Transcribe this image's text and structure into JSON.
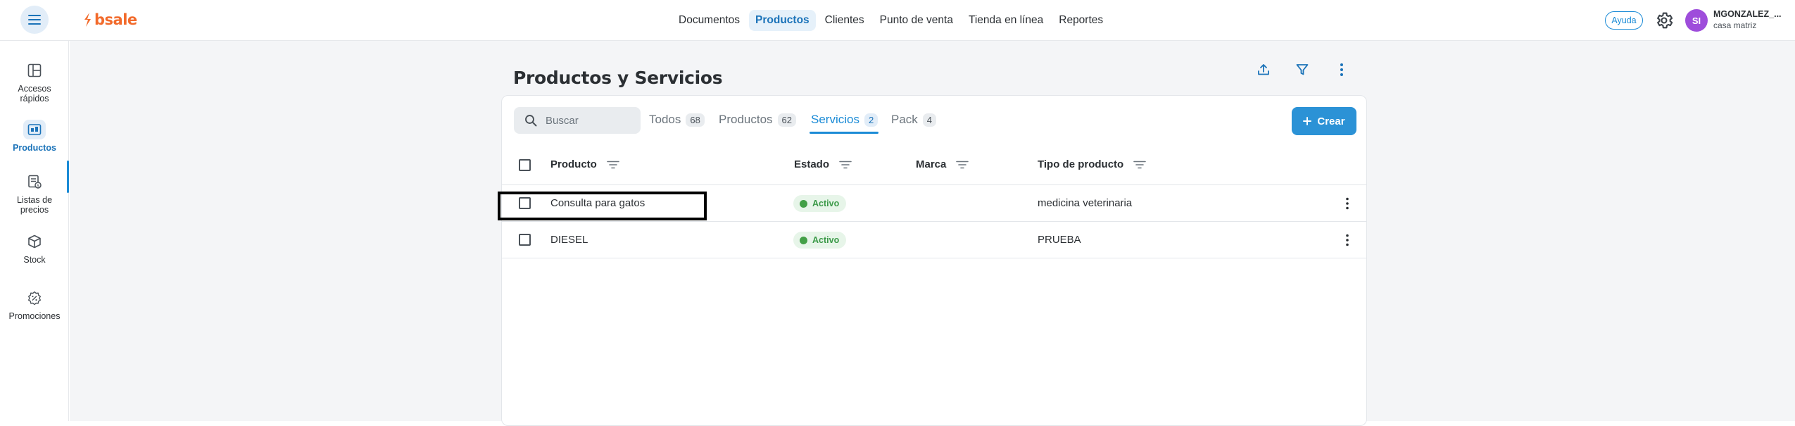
{
  "brand": {
    "logo_text": "bsale",
    "logo_color": "#f26b2c"
  },
  "header": {
    "menu_icon": "hamburger-icon",
    "nav": [
      "Documentos",
      "Productos",
      "Clientes",
      "Punto de venta",
      "Tienda en línea",
      "Reportes"
    ],
    "active_nav": "Productos",
    "help_label": "Ayuda",
    "settings_icon": "gear-icon",
    "avatar_initials": "SI",
    "user_name": "MGONZALEZ_...",
    "user_branch": "casa matriz"
  },
  "sidebar": {
    "items": [
      {
        "label": "Accesos rápidos",
        "icon": "dashboard-icon"
      },
      {
        "label": "Productos",
        "icon": "products-icon",
        "active": true
      },
      {
        "label": "Listas de precios",
        "icon": "price-list-icon"
      },
      {
        "label": "Stock",
        "icon": "box-icon"
      },
      {
        "label": "Promociones",
        "icon": "promotion-icon"
      }
    ]
  },
  "page": {
    "title": "Productos y Servicios",
    "actions": [
      "upload-icon",
      "filter-icon",
      "more-vert-icon"
    ]
  },
  "toolbar": {
    "search_placeholder": "Buscar",
    "tabs": [
      {
        "label": "Todos",
        "count": "68"
      },
      {
        "label": "Productos",
        "count": "62"
      },
      {
        "label": "Servicios",
        "count": "2",
        "active": true
      },
      {
        "label": "Pack",
        "count": "4"
      }
    ],
    "create_label": "Crear"
  },
  "table": {
    "columns": [
      "Producto",
      "Estado",
      "Marca",
      "Tipo de producto"
    ],
    "rows": [
      {
        "producto": "Consulta para gatos",
        "estado": "Activo",
        "marca": "",
        "tipo": "medicina veterinaria"
      },
      {
        "producto": "DIESEL",
        "estado": "Activo",
        "marca": "",
        "tipo": "PRUEBA"
      }
    ]
  },
  "colors": {
    "accent": "#1b8bd6",
    "active_green": "#43a047",
    "background": "#f4f5f7"
  }
}
